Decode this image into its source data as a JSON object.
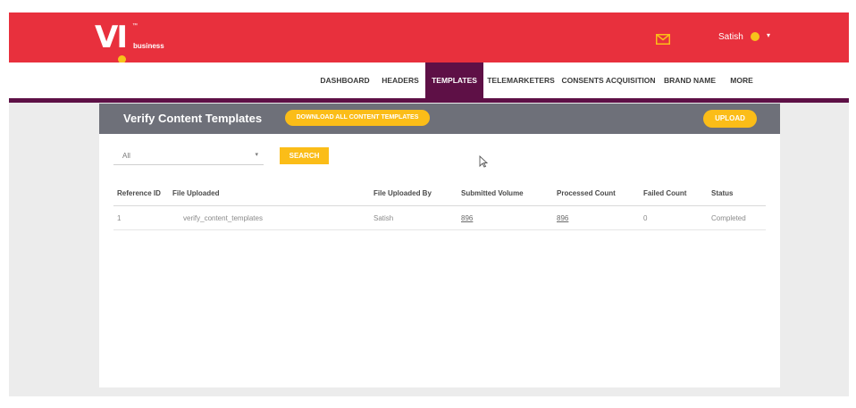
{
  "brand": {
    "logo_text": "VI",
    "trademark": "™",
    "sub": "business",
    "primary": "#e8303d",
    "accent": "#fbbd18",
    "nav_active": "#5e1046"
  },
  "header": {
    "user_name": "Satish",
    "mail_icon": "mail-icon",
    "user_icon": "user-icon",
    "caret": "▾"
  },
  "nav": {
    "items": [
      "DASHBOARD",
      "HEADERS",
      "TEMPLATES",
      "TELEMARKETERS",
      "CONSENTS ACQUISITION",
      "BRAND NAME",
      "MORE"
    ],
    "active": "TEMPLATES"
  },
  "panel": {
    "title": "Verify Content Templates",
    "download_label": "DOWNLOAD ALL CONTENT TEMPLATES",
    "upload_label": "UPLOAD",
    "filter": {
      "selected": "All",
      "caret": "▾"
    },
    "search_label": "SEARCH"
  },
  "table": {
    "headers": [
      "Reference ID",
      "File Uploaded",
      "File Uploaded By",
      "Submitted Volume",
      "Processed Count",
      "Failed Count",
      "Status"
    ],
    "rows": [
      {
        "ref": "1",
        "file": "verify_content_templates",
        "by": "Satish",
        "submitted": "896",
        "processed": "896",
        "failed": "0",
        "status": "Completed"
      }
    ]
  }
}
